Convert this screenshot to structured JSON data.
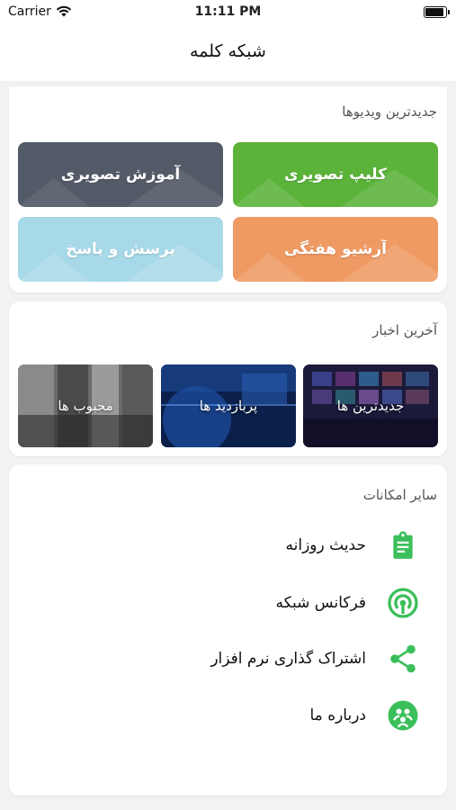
{
  "status_bar": {
    "carrier": "Carrier",
    "time": "11:11 PM"
  },
  "nav": {
    "title": "شبکه کلمه"
  },
  "videos": {
    "title": "جدیدترین ویدیوها",
    "tiles": [
      {
        "label": "کلیپ تصویری",
        "color": "#5bb33a"
      },
      {
        "label": "آموزش تصویری",
        "color": "#545b68"
      },
      {
        "label": "آرشیو هفتگی",
        "color": "#ef9a63"
      },
      {
        "label": "پرسش و پاسخ",
        "color": "#a7d9e8"
      }
    ]
  },
  "news": {
    "title": "آخرین اخبار",
    "items": [
      {
        "label": "جدیدترین ها"
      },
      {
        "label": "پربازدید ها"
      },
      {
        "label": "محبوب ها"
      }
    ]
  },
  "features": {
    "title": "سایر امکانات",
    "accent": "#3bbf5a",
    "items": [
      {
        "label": "حدیث روزانه",
        "icon": "clipboard-icon"
      },
      {
        "label": "فرکانس شبکه",
        "icon": "broadcast-icon"
      },
      {
        "label": "اشتراک گذاری نرم افزار",
        "icon": "share-icon"
      },
      {
        "label": "درباره ما",
        "icon": "about-icon"
      }
    ]
  }
}
